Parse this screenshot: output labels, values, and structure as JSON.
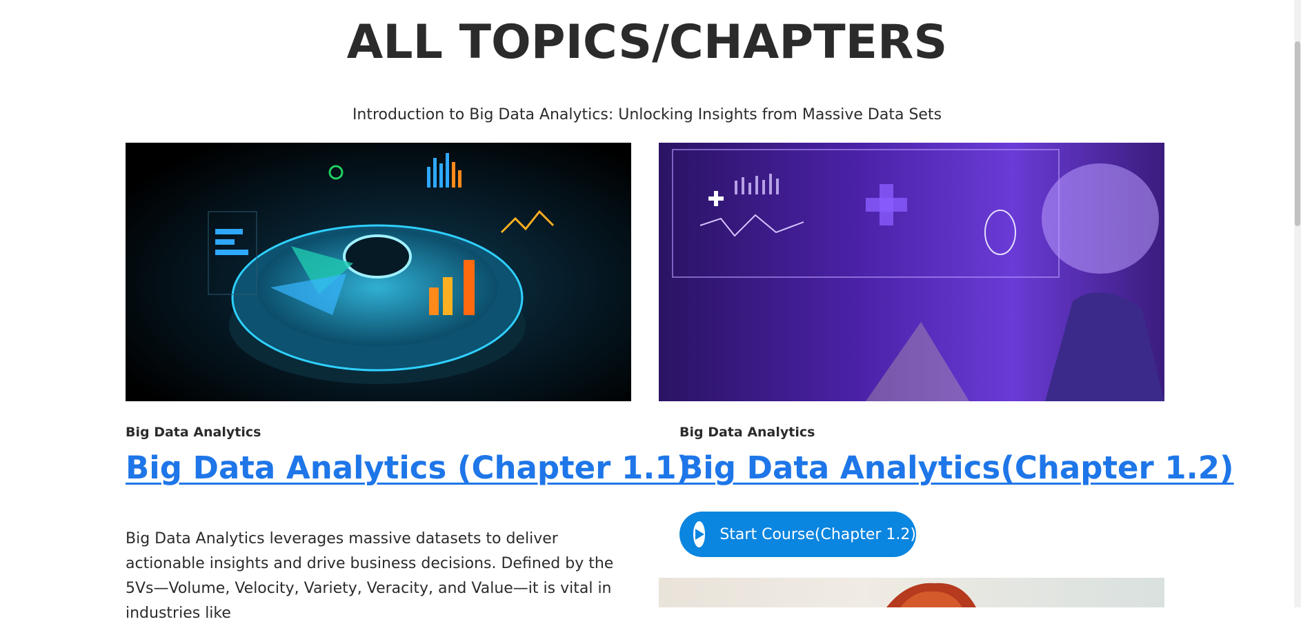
{
  "page": {
    "title": "ALL TOPICS/CHAPTERS",
    "subtitle": "Introduction to Big Data Analytics: Unlocking Insights from Massive Data Sets"
  },
  "cards": [
    {
      "category": "Big Data Analytics",
      "title": "Big Data Analytics (Chapter 1.1)",
      "description": "Big Data Analytics leverages massive datasets to deliver actionable insights and drive business decisions. Defined by the 5Vs—Volume, Velocity, Variety, Veracity, and Value—it is vital in industries like"
    },
    {
      "category": "Big Data Analytics",
      "title": "Big Data Analytics(Chapter 1.2)",
      "button_label": "Start Course(Chapter 1.2)"
    }
  ],
  "colors": {
    "link": "#1e76e8",
    "button": "#0a85e0",
    "text": "#2b2b2b"
  },
  "icons": {
    "start_button_icon": "play-circle-icon"
  }
}
